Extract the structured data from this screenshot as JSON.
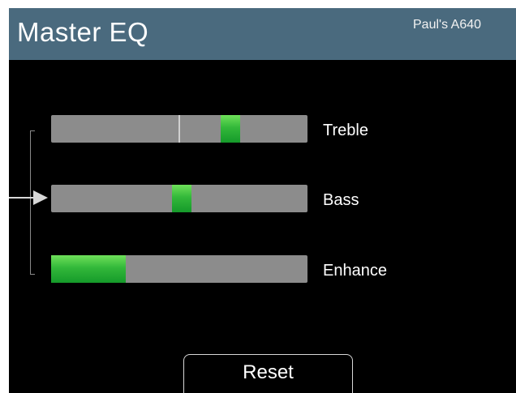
{
  "header": {
    "title": "Master EQ",
    "device_name": "Paul's A640"
  },
  "eq": {
    "treble": {
      "label": "Treble",
      "value": 0.7,
      "center_mark": 0.5
    },
    "bass": {
      "label": "Bass",
      "value": 0.51
    },
    "enhance": {
      "label": "Enhance",
      "value": 0.29
    }
  },
  "actions": {
    "reset_label": "Reset"
  },
  "colors": {
    "header_bg": "#4a6a7e",
    "background": "#000000",
    "track": "#8c8c8c",
    "accent_green": "#33b83a",
    "text": "#ffffff"
  },
  "icons": {
    "group_bracket": "group-bracket-icon",
    "pointer": "arrow-right-icon"
  }
}
